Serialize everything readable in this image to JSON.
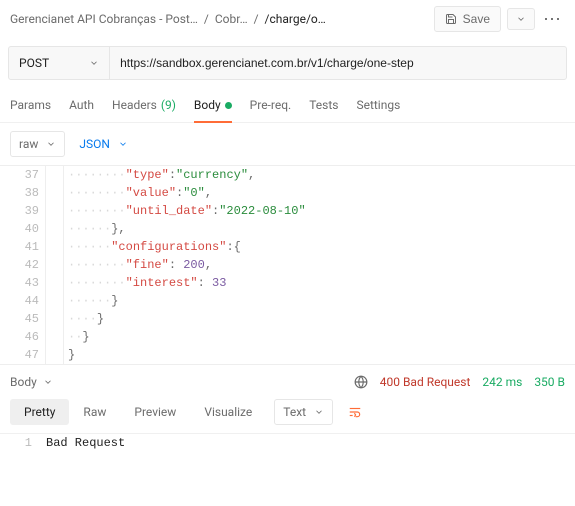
{
  "breadcrumb": {
    "root": "Gerencianet API Cobranças - Post…",
    "mid": "Cobr…",
    "leaf": "/charge/o…"
  },
  "save": {
    "label": "Save"
  },
  "request": {
    "method": "POST",
    "url": "https://sandbox.gerencianet.com.br/v1/charge/one-step"
  },
  "tabs": {
    "params": "Params",
    "auth": "Auth",
    "headers": "Headers",
    "headers_count": "(9)",
    "body": "Body",
    "prereq": "Pre-req.",
    "tests": "Tests",
    "settings": "Settings"
  },
  "subbar": {
    "raw": "raw",
    "json": "JSON"
  },
  "editor_lines": [
    {
      "n": 37,
      "seg": [
        [
          "dots",
          "········"
        ],
        [
          "t-key",
          "\"type\""
        ],
        [
          "t-pun",
          ":"
        ],
        [
          "t-str",
          "\"currency\""
        ],
        [
          "t-pun",
          ","
        ]
      ]
    },
    {
      "n": 38,
      "seg": [
        [
          "dots",
          "········"
        ],
        [
          "t-key",
          "\"value\""
        ],
        [
          "t-pun",
          ":"
        ],
        [
          "t-str",
          "\"0\""
        ],
        [
          "t-pun",
          ","
        ]
      ]
    },
    {
      "n": 39,
      "seg": [
        [
          "dots",
          "········"
        ],
        [
          "t-key",
          "\"until_date\""
        ],
        [
          "t-pun",
          ":"
        ],
        [
          "t-str",
          "\"2022-08-10\""
        ]
      ]
    },
    {
      "n": 40,
      "seg": [
        [
          "dots",
          "······"
        ],
        [
          "t-pun",
          "},"
        ]
      ]
    },
    {
      "n": 41,
      "seg": [
        [
          "dots",
          "······"
        ],
        [
          "t-key",
          "\"configurations\""
        ],
        [
          "t-pun",
          ":{"
        ]
      ]
    },
    {
      "n": 42,
      "seg": [
        [
          "dots",
          "········"
        ],
        [
          "t-key",
          "\"fine\""
        ],
        [
          "t-pun",
          ": "
        ],
        [
          "t-num",
          "200"
        ],
        [
          "t-pun",
          ","
        ]
      ]
    },
    {
      "n": 43,
      "seg": [
        [
          "dots",
          "········"
        ],
        [
          "t-key",
          "\"interest\""
        ],
        [
          "t-pun",
          ": "
        ],
        [
          "t-num",
          "33"
        ]
      ]
    },
    {
      "n": 44,
      "seg": [
        [
          "dots",
          "······"
        ],
        [
          "t-pun",
          "}"
        ]
      ]
    },
    {
      "n": 45,
      "seg": [
        [
          "dots",
          "····"
        ],
        [
          "t-pun",
          "}"
        ]
      ]
    },
    {
      "n": 46,
      "seg": [
        [
          "dots",
          "··"
        ],
        [
          "t-pun",
          "}"
        ]
      ]
    },
    {
      "n": 47,
      "seg": [
        [
          "t-pun",
          "}"
        ]
      ]
    }
  ],
  "response": {
    "label": "Body",
    "status": "400 Bad Request",
    "time": "242 ms",
    "size": "350 B",
    "tabs": {
      "pretty": "Pretty",
      "raw": "Raw",
      "preview": "Preview",
      "visualize": "Visualize"
    },
    "mode": "Text",
    "body_lines": [
      {
        "n": 1,
        "text": "Bad Request"
      }
    ]
  }
}
